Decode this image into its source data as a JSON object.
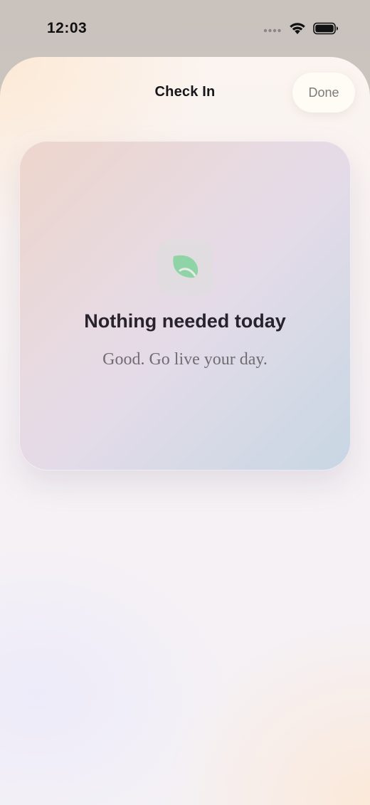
{
  "status_bar": {
    "time": "12:03",
    "icons": [
      "signal-dots-icon",
      "wifi-icon",
      "battery-icon"
    ]
  },
  "sheet": {
    "title": "Check In",
    "done_label": "Done"
  },
  "card": {
    "icon": "leaf-icon",
    "icon_color": "#8fd4a6",
    "title": "Nothing needed today",
    "subtitle": "Good. Go live your day."
  }
}
